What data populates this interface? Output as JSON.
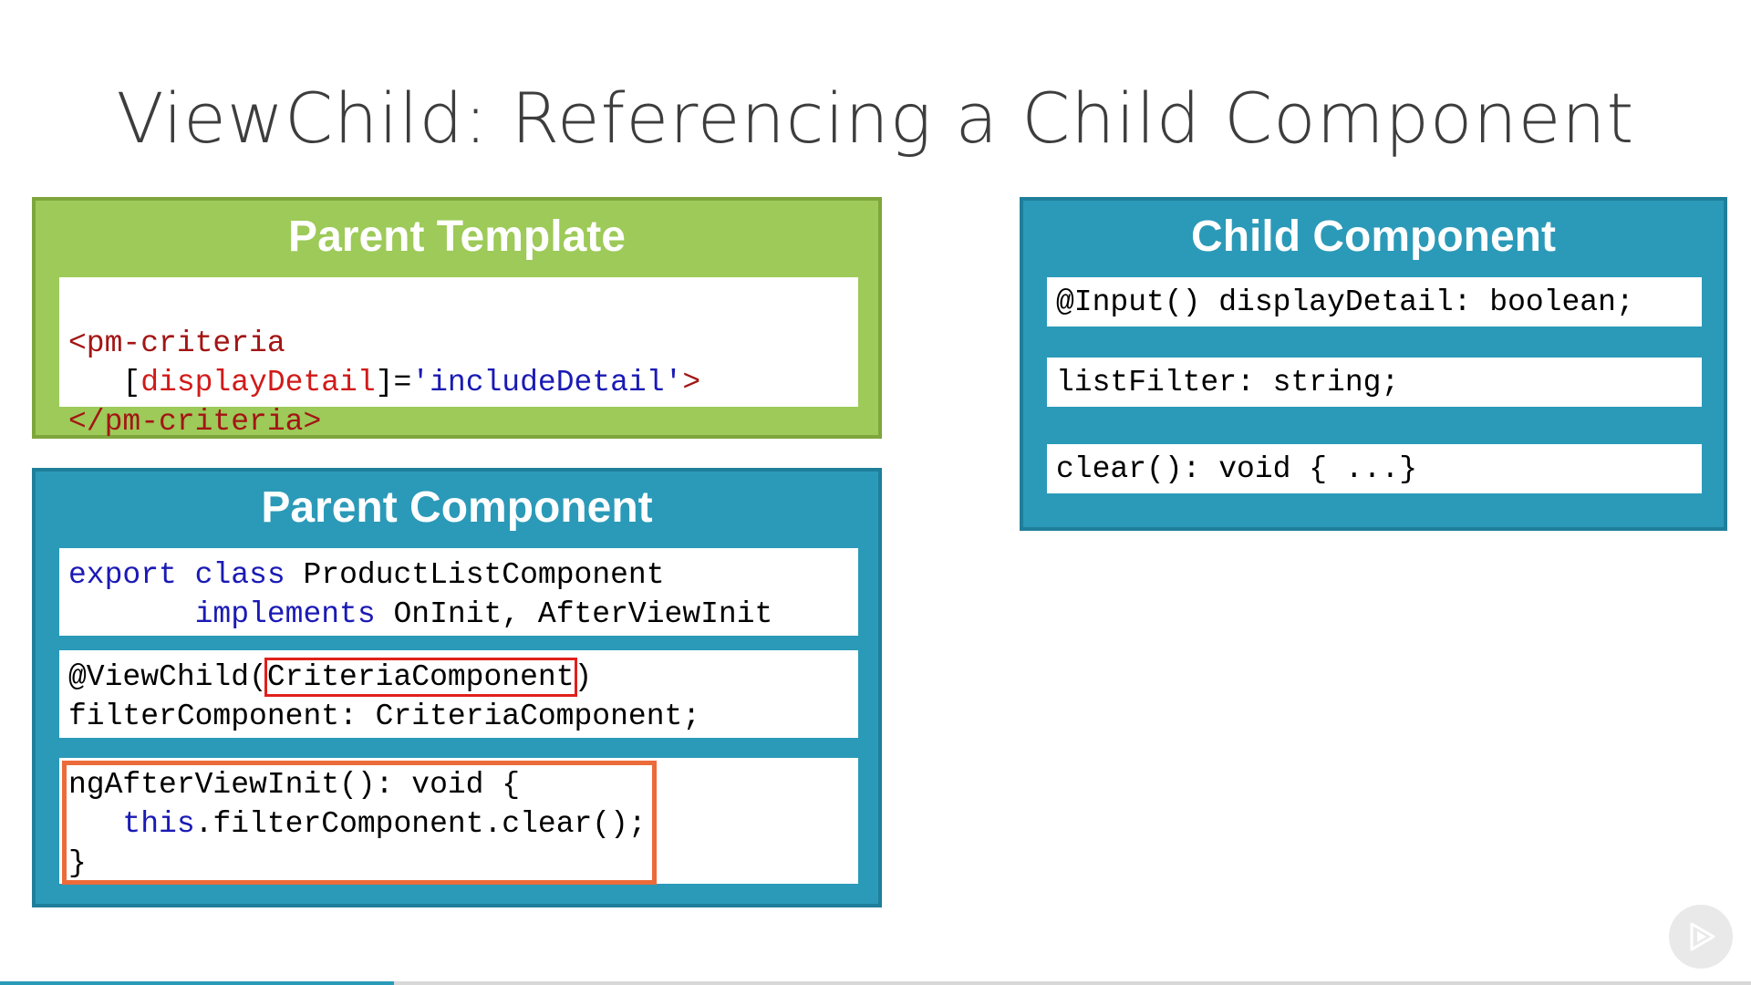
{
  "slide": {
    "title": "ViewChild: Referencing a Child Component"
  },
  "parent_template": {
    "heading": "Parent Template",
    "line1_tag": "<pm-criteria",
    "line2_indent": "   [",
    "line2_attr": "displayDetail",
    "line2_mid": "]=",
    "line2_str": "'includeDetail'",
    "line2_end": ">",
    "line3_tag": "</pm-criteria>"
  },
  "parent_component": {
    "heading": "Parent Component",
    "block1_kw1": "export",
    "block1_kw2": "class",
    "block1_name": " ProductListComponent",
    "block1_kw3": "implements",
    "block1_rest": " OnInit, AfterViewInit",
    "block2_line1_pre": "@ViewChild(",
    "block2_line1_hl": "CriteriaComponent",
    "block2_line1_post": ")",
    "block2_line2": "filterComponent: CriteriaComponent;",
    "block3_line1": "ngAfterViewInit(): void {",
    "block3_kw": "this",
    "block3_line2_rest": ".filterComponent.clear();",
    "block3_line3": "}"
  },
  "child_component": {
    "heading": "Child Component",
    "line1": "@Input() displayDetail: boolean;",
    "line2": "listFilter: string;",
    "line3": "clear(): void { ...}"
  },
  "player": {
    "play_icon": "play-icon",
    "progress_fraction": 0.225
  },
  "colors": {
    "green": "#9dca58",
    "teal": "#2b9ab8",
    "highlight_red": "#e0201a",
    "highlight_orange": "#ec6b3a"
  }
}
